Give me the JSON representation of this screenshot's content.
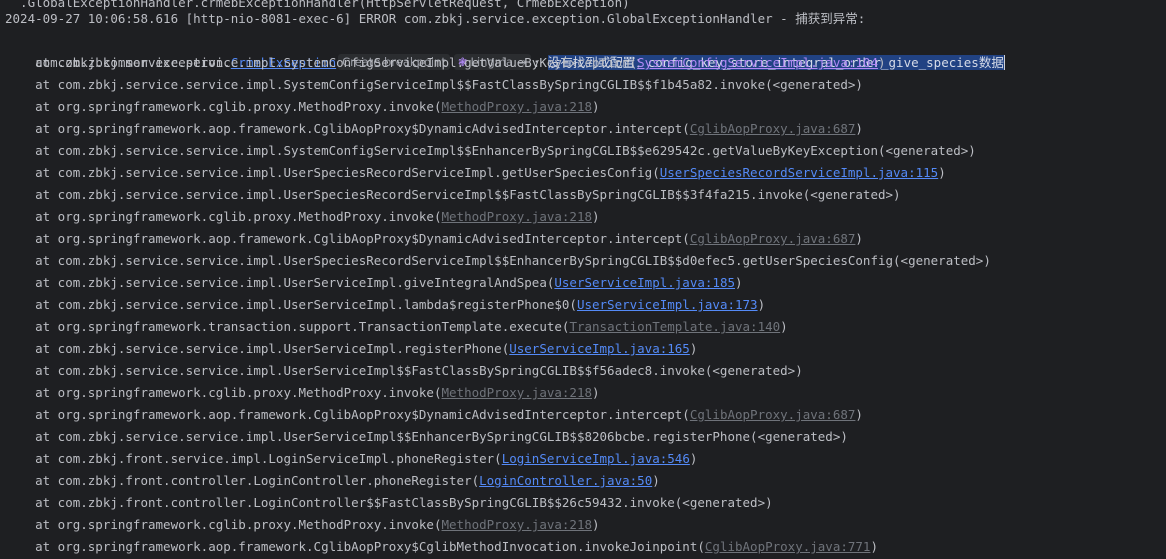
{
  "top_partial": "  .GlobalExceptionHandler.crmebExceptionHandler(HttpServletRequest, CrmebException)",
  "header": "2024-09-27 10:06:58.616 [http-nio-8081-exec-6] ERROR com.zbkj.service.exception.GlobalExceptionHandler - 捕获到异常:",
  "exception": {
    "package_prefix": "com.zbkj.common.exception.",
    "class_link": "CrmebException",
    "chip_breakpoint": "Create breakpoint",
    "chip_lingma": "Lingma",
    "lingma_icon": "❃",
    "arrow_icon": "→",
    "separator": ": ",
    "message": "没有找到或配置：config_key_store_integral_order_give_species数据"
  },
  "frames": [
    {
      "text": "    at com.zbkj.service.service.impl.SystemConfigServiceImpl.getValueByKeyException(",
      "link": "SystemConfigServiceImpl.java:104",
      "style": "purple",
      "end": ")"
    },
    {
      "text": "    at com.zbkj.service.service.impl.SystemConfigServiceImpl$$FastClassBySpringCGLIB$$f1b45a82.invoke(<generated>)",
      "link": "",
      "style": "",
      "end": ""
    },
    {
      "text": "    at org.springframework.cglib.proxy.MethodProxy.invoke(",
      "link": "MethodProxy.java:218",
      "style": "gray",
      "end": ")"
    },
    {
      "text": "    at org.springframework.aop.framework.CglibAopProxy$DynamicAdvisedInterceptor.intercept(",
      "link": "CglibAopProxy.java:687",
      "style": "gray",
      "end": ")"
    },
    {
      "text": "    at com.zbkj.service.service.impl.SystemConfigServiceImpl$$EnhancerBySpringCGLIB$$e629542c.getValueByKeyException(<generated>)",
      "link": "",
      "style": "",
      "end": ""
    },
    {
      "text": "    at com.zbkj.service.service.impl.UserSpeciesRecordServiceImpl.getUserSpeciesConfig(",
      "link": "UserSpeciesRecordServiceImpl.java:115",
      "style": "blue",
      "end": ")"
    },
    {
      "text": "    at com.zbkj.service.service.impl.UserSpeciesRecordServiceImpl$$FastClassBySpringCGLIB$$3f4fa215.invoke(<generated>)",
      "link": "",
      "style": "",
      "end": ""
    },
    {
      "text": "    at org.springframework.cglib.proxy.MethodProxy.invoke(",
      "link": "MethodProxy.java:218",
      "style": "gray",
      "end": ")"
    },
    {
      "text": "    at org.springframework.aop.framework.CglibAopProxy$DynamicAdvisedInterceptor.intercept(",
      "link": "CglibAopProxy.java:687",
      "style": "gray",
      "end": ")"
    },
    {
      "text": "    at com.zbkj.service.service.impl.UserSpeciesRecordServiceImpl$$EnhancerBySpringCGLIB$$d0efec5.getUserSpeciesConfig(<generated>)",
      "link": "",
      "style": "",
      "end": ""
    },
    {
      "text": "    at com.zbkj.service.service.impl.UserServiceImpl.giveIntegralAndSpea(",
      "link": "UserServiceImpl.java:185",
      "style": "blue",
      "end": ")"
    },
    {
      "text": "    at com.zbkj.service.service.impl.UserServiceImpl.lambda$registerPhone$0(",
      "link": "UserServiceImpl.java:173",
      "style": "blue",
      "end": ")"
    },
    {
      "text": "    at org.springframework.transaction.support.TransactionTemplate.execute(",
      "link": "TransactionTemplate.java:140",
      "style": "gray",
      "end": ")"
    },
    {
      "text": "    at com.zbkj.service.service.impl.UserServiceImpl.registerPhone(",
      "link": "UserServiceImpl.java:165",
      "style": "blue",
      "end": ")"
    },
    {
      "text": "    at com.zbkj.service.service.impl.UserServiceImpl$$FastClassBySpringCGLIB$$f56adec8.invoke(<generated>)",
      "link": "",
      "style": "",
      "end": ""
    },
    {
      "text": "    at org.springframework.cglib.proxy.MethodProxy.invoke(",
      "link": "MethodProxy.java:218",
      "style": "gray",
      "end": ")"
    },
    {
      "text": "    at org.springframework.aop.framework.CglibAopProxy$DynamicAdvisedInterceptor.intercept(",
      "link": "CglibAopProxy.java:687",
      "style": "gray",
      "end": ")"
    },
    {
      "text": "    at com.zbkj.service.service.impl.UserServiceImpl$$EnhancerBySpringCGLIB$$8206bcbe.registerPhone(<generated>)",
      "link": "",
      "style": "",
      "end": ""
    },
    {
      "text": "    at com.zbkj.front.service.impl.LoginServiceImpl.phoneRegister(",
      "link": "LoginServiceImpl.java:546",
      "style": "blue",
      "end": ")"
    },
    {
      "text": "    at com.zbkj.front.controller.LoginController.phoneRegister(",
      "link": "LoginController.java:50",
      "style": "blue",
      "end": ")"
    },
    {
      "text": "    at com.zbkj.front.controller.LoginController$$FastClassBySpringCGLIB$$26c59432.invoke(<generated>)",
      "link": "",
      "style": "",
      "end": ""
    },
    {
      "text": "    at org.springframework.cglib.proxy.MethodProxy.invoke(",
      "link": "MethodProxy.java:218",
      "style": "gray",
      "end": ")"
    },
    {
      "text": "    at org.springframework.aop.framework.CglibAopProxy$CglibMethodInvocation.invokeJoinpoint(",
      "link": "CglibAopProxy.java:771",
      "style": "gray",
      "end": ")"
    }
  ]
}
